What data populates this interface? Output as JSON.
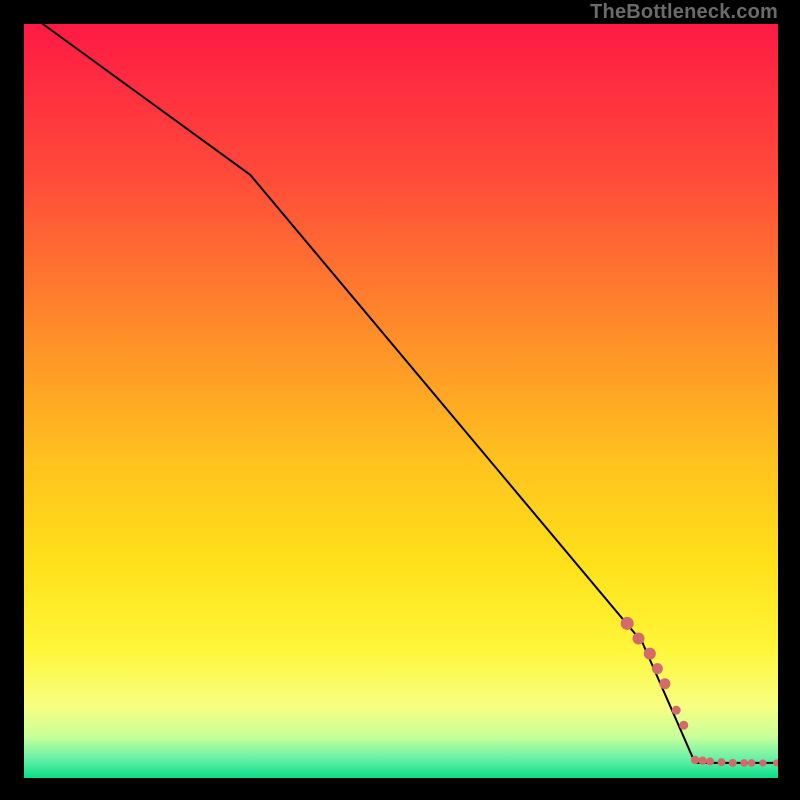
{
  "watermark": "TheBottleneck.com",
  "gradient": {
    "stops": [
      {
        "offset": 0.0,
        "color": "#ff1a44"
      },
      {
        "offset": 0.2,
        "color": "#ff4a3a"
      },
      {
        "offset": 0.4,
        "color": "#ff8a2a"
      },
      {
        "offset": 0.58,
        "color": "#ffc21e"
      },
      {
        "offset": 0.72,
        "color": "#ffe21a"
      },
      {
        "offset": 0.83,
        "color": "#fff63a"
      },
      {
        "offset": 0.905,
        "color": "#f7ff82"
      },
      {
        "offset": 0.945,
        "color": "#c8ff9a"
      },
      {
        "offset": 0.975,
        "color": "#66f0a8"
      },
      {
        "offset": 1.0,
        "color": "#0adf86"
      }
    ]
  },
  "chart_data": {
    "type": "line",
    "title": "",
    "xlabel": "",
    "ylabel": "",
    "xlim": [
      0,
      100
    ],
    "ylim": [
      0,
      100
    ],
    "grid": false,
    "series": [
      {
        "name": "curve",
        "color": "#000000",
        "points": [
          {
            "x": 2.5,
            "y": 100.0
          },
          {
            "x": 30.0,
            "y": 80.0
          },
          {
            "x": 82.0,
            "y": 18.0
          },
          {
            "x": 89.0,
            "y": 2.0
          },
          {
            "x": 100.0,
            "y": 2.0
          }
        ]
      }
    ],
    "markers": {
      "name": "points",
      "color": "#d46a6a",
      "radius_min": 3.5,
      "radius_max": 6.5,
      "items": [
        {
          "x": 80.0,
          "y": 20.5,
          "r": 6.5
        },
        {
          "x": 81.5,
          "y": 18.5,
          "r": 6.0
        },
        {
          "x": 83.0,
          "y": 16.5,
          "r": 6.0
        },
        {
          "x": 84.0,
          "y": 14.5,
          "r": 5.5
        },
        {
          "x": 85.0,
          "y": 12.5,
          "r": 5.5
        },
        {
          "x": 86.5,
          "y": 9.0,
          "r": 4.5
        },
        {
          "x": 87.5,
          "y": 7.0,
          "r": 4.5
        },
        {
          "x": 89.0,
          "y": 2.4,
          "r": 4.2
        },
        {
          "x": 90.0,
          "y": 2.3,
          "r": 4.2
        },
        {
          "x": 91.0,
          "y": 2.2,
          "r": 4.0
        },
        {
          "x": 92.5,
          "y": 2.1,
          "r": 4.0
        },
        {
          "x": 94.0,
          "y": 2.0,
          "r": 4.0
        },
        {
          "x": 95.5,
          "y": 2.0,
          "r": 3.8
        },
        {
          "x": 96.5,
          "y": 2.0,
          "r": 3.8
        },
        {
          "x": 98.0,
          "y": 2.0,
          "r": 3.6
        },
        {
          "x": 99.8,
          "y": 2.0,
          "r": 3.5
        }
      ]
    }
  }
}
